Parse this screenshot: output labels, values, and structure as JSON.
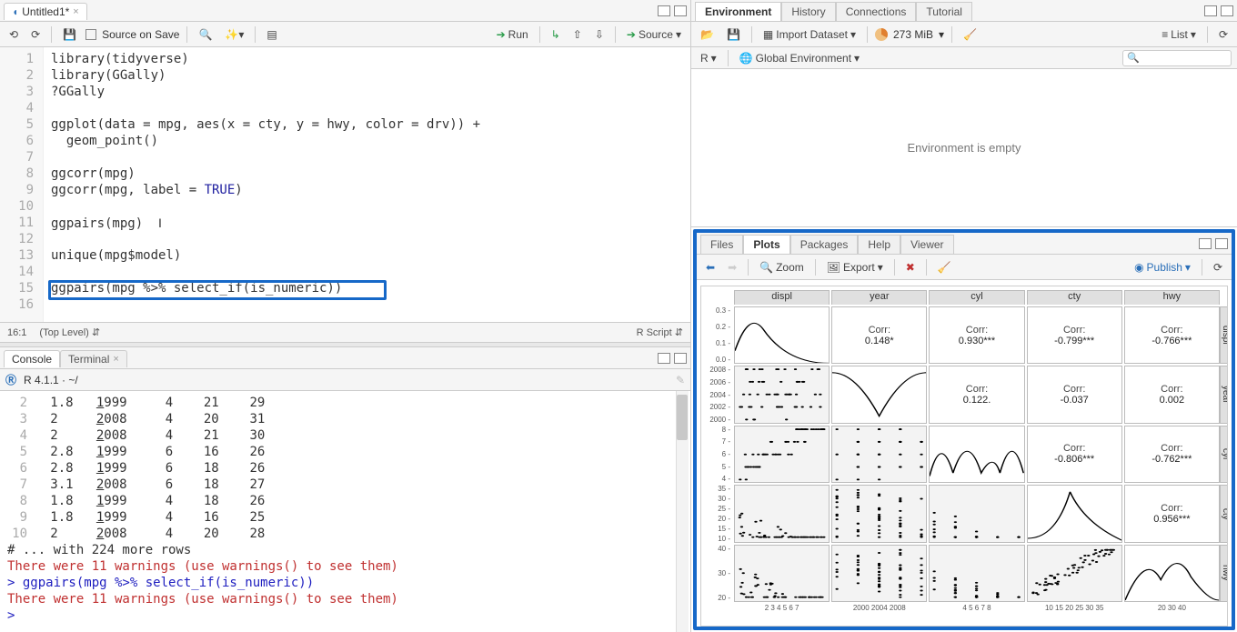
{
  "source": {
    "tab_title": "Untitled1*",
    "toolbar": {
      "source_on_save": "Source on Save",
      "run": "Run",
      "source": "Source"
    },
    "lines": [
      "library(tidyverse)",
      "library(GGally)",
      "?GGally",
      "",
      "ggplot(data = mpg, aes(x = cty, y = hwy, color = drv)) +",
      "  geom_point()",
      "",
      "ggcorr(mpg)",
      "ggcorr(mpg, label = TRUE)",
      "",
      "ggpairs(mpg)",
      "",
      "unique(mpg$model)",
      "",
      "ggpairs(mpg %>% select_if(is_numeric))",
      ""
    ],
    "status_left": "16:1",
    "status_scope": "(Top Level)",
    "status_lang": "R Script"
  },
  "console": {
    "tab1": "Console",
    "tab2": "Terminal",
    "version": "R 4.1.1 · ~/",
    "rows": [
      {
        "n": "2",
        "displ": "1.8",
        "year": "1999",
        "cyl": "4",
        "cty": "21",
        "hwy": "29"
      },
      {
        "n": "3",
        "displ": "2  ",
        "year": "2008",
        "cyl": "4",
        "cty": "20",
        "hwy": "31"
      },
      {
        "n": "4",
        "displ": "2  ",
        "year": "2008",
        "cyl": "4",
        "cty": "21",
        "hwy": "30"
      },
      {
        "n": "5",
        "displ": "2.8",
        "year": "1999",
        "cyl": "6",
        "cty": "16",
        "hwy": "26"
      },
      {
        "n": "6",
        "displ": "2.8",
        "year": "1999",
        "cyl": "6",
        "cty": "18",
        "hwy": "26"
      },
      {
        "n": "7",
        "displ": "3.1",
        "year": "2008",
        "cyl": "6",
        "cty": "18",
        "hwy": "27"
      },
      {
        "n": "8",
        "displ": "1.8",
        "year": "1999",
        "cyl": "4",
        "cty": "18",
        "hwy": "26"
      },
      {
        "n": "9",
        "displ": "1.8",
        "year": "1999",
        "cyl": "4",
        "cty": "16",
        "hwy": "25"
      },
      {
        "n": "10",
        "displ": "2  ",
        "year": "2008",
        "cyl": "4",
        "cty": "20",
        "hwy": "28"
      }
    ],
    "more_rows": "# ... with 224 more rows",
    "warn1": "There were 11 warnings (use warnings() to see them)",
    "cmd": "> ggpairs(mpg %>% select_if(is_numeric))",
    "warn2": "There were 11 warnings (use warnings() to see them)",
    "prompt": "> "
  },
  "env": {
    "tabs": [
      "Environment",
      "History",
      "Connections",
      "Tutorial"
    ],
    "import": "Import Dataset",
    "mem": "273 MiB",
    "lang": "R",
    "scope": "Global Environment",
    "list": "List",
    "empty": "Environment is empty"
  },
  "plots": {
    "tabs": [
      "Files",
      "Plots",
      "Packages",
      "Help",
      "Viewer"
    ],
    "zoom": "Zoom",
    "export": "Export",
    "publish": "Publish"
  },
  "chart_data": {
    "type": "pairs_matrix",
    "vars": [
      "displ",
      "year",
      "cyl",
      "cty",
      "hwy"
    ],
    "corr": {
      "displ_year": "0.148*",
      "displ_cyl": "0.930***",
      "displ_cty": "-0.799***",
      "displ_hwy": "-0.766***",
      "year_cyl": "0.122.",
      "year_cty": "-0.037",
      "year_hwy": "0.002",
      "cyl_cty": "-0.806***",
      "cyl_hwy": "-0.762***",
      "cty_hwy": "0.956***"
    },
    "ticks": {
      "displ": [
        "0.3",
        "0.2",
        "0.1",
        "0.0"
      ],
      "year": [
        "2008",
        "2006",
        "2004",
        "2002",
        "2000"
      ],
      "cyl": [
        "8",
        "7",
        "6",
        "5",
        "4"
      ],
      "cty": [
        "35",
        "30",
        "25",
        "20",
        "15",
        "10"
      ],
      "hwy": [
        "40",
        "30",
        "20"
      ]
    },
    "xticks": {
      "displ": "2 3 4 5 6 7",
      "year": "2000 2004 2008",
      "cyl": "4 5 6 7 8",
      "cty": "10 15 20 25 30 35",
      "hwy": "20 30 40"
    }
  }
}
